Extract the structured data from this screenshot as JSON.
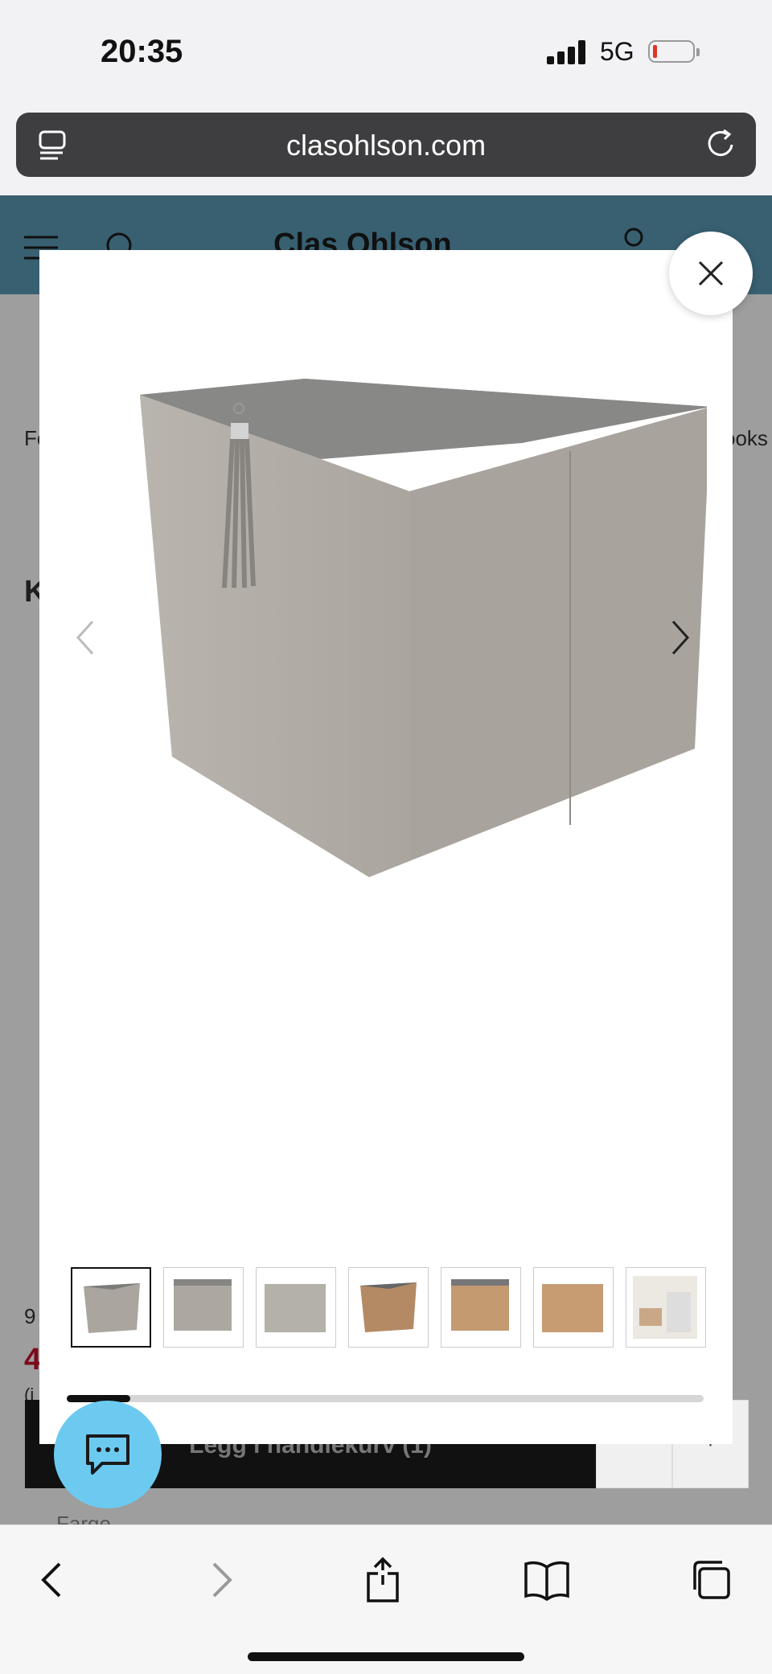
{
  "status_bar": {
    "time": "20:35",
    "network": "5G"
  },
  "browser": {
    "url": "clasohlson.com"
  },
  "site": {
    "logo": "Clas Ohlson"
  },
  "background": {
    "frag_left": "Fo",
    "frag_right": "ooks",
    "frag_k": "K",
    "frag_price_old": "9",
    "frag_price_new": "4",
    "frag_incl": "(i",
    "farge": "Farge"
  },
  "gallery": {
    "thumbnails": [
      {
        "color": "grey"
      },
      {
        "color": "grey"
      },
      {
        "color": "grey"
      },
      {
        "color": "tan"
      },
      {
        "color": "tan"
      },
      {
        "color": "tan"
      },
      {
        "color": "lifestyle"
      }
    ],
    "active_index": 0,
    "scroll_progress": 0.1
  },
  "cart": {
    "add_label": "Legg i handlekurv (1)",
    "minus": "-",
    "plus": "+"
  },
  "colors": {
    "header": "#5b9bb7",
    "chat": "#6ccaf0"
  }
}
